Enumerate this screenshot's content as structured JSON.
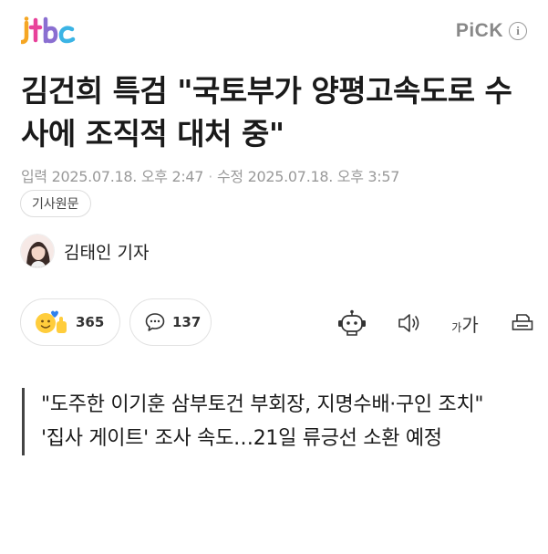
{
  "header": {
    "logo_alt": "jtbc",
    "pick_label": "PiCK",
    "info_glyph": "i"
  },
  "article": {
    "headline": "김건희 특검 \"국토부가 양평고속도로 수사에 조직적 대처 중\"",
    "published_label": "입력",
    "published_time": "2025.07.18. 오후 2:47",
    "modified_label": "수정",
    "modified_time": "2025.07.18. 오후 3:57",
    "original_button": "기사원문",
    "author": "김태인 기자"
  },
  "reactions": {
    "like_count": "365",
    "comment_count": "137"
  },
  "tools": {
    "font_small": "가",
    "font_big": "가",
    "icons": [
      "summary-bot-icon",
      "text-to-speech-icon",
      "font-size-icon",
      "print-icon"
    ]
  },
  "summary": [
    "\"도주한 이기훈 삼부토건 부회장, 지명수배·구인 조치\"",
    "'집사 게이트' 조사 속도…21일 류긍선 소환 예정"
  ],
  "colors": {
    "accent_gray": "#888888",
    "text": "#1a1a1a",
    "border": "#e2e2e2",
    "logo_orange": "#f28c28",
    "logo_pink": "#e8419a",
    "logo_blue": "#3bb4e5"
  }
}
